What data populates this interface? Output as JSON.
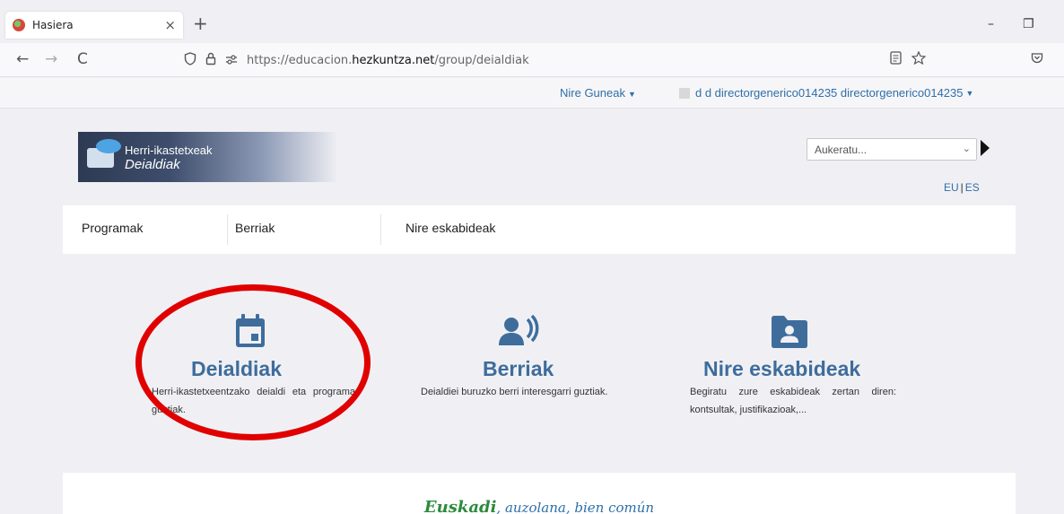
{
  "browser": {
    "tab_title": "Hasiera",
    "tab_close": "×",
    "new_tab": "+",
    "win_min": "–",
    "win_max": "❐",
    "url_prefix": "https://educacion.",
    "url_domain": "hezkuntza.net",
    "url_path": "/group/deialdiak",
    "nav_back": "←",
    "nav_forward": "→",
    "nav_reload": "C"
  },
  "site_top": {
    "my_sites": "Nire Guneak",
    "user": "d d directorgenerico014235 directorgenerico014235"
  },
  "header": {
    "logo_line1": "Herri-ikastetxeak",
    "logo_line2": "Deialdiak",
    "select_value": "Aukeratu...",
    "lang_eu": "EU",
    "lang_sep": "|",
    "lang_es": "ES"
  },
  "menu": {
    "items": [
      "Programak",
      "Berriak",
      "Nire eskabideak"
    ]
  },
  "cards": [
    {
      "title": "Deialdiak",
      "desc": "Herri-ikastetxeentzako deialdi eta programa guztiak."
    },
    {
      "title": "Berriak",
      "desc": "Deialdiei buruzko berri interesgarri guztiak."
    },
    {
      "title": "Nire eskabideak",
      "desc": "Begiratu zure eskabideak zertan diren: kontsultak, justifikazioak,..."
    }
  ],
  "footer": {
    "motto_a": "Euskadi",
    "motto_b": ", auzolana, bien común"
  },
  "colors": {
    "accent": "#3e6d9c",
    "link": "#2f6fa8",
    "annotation": "#e00000"
  }
}
